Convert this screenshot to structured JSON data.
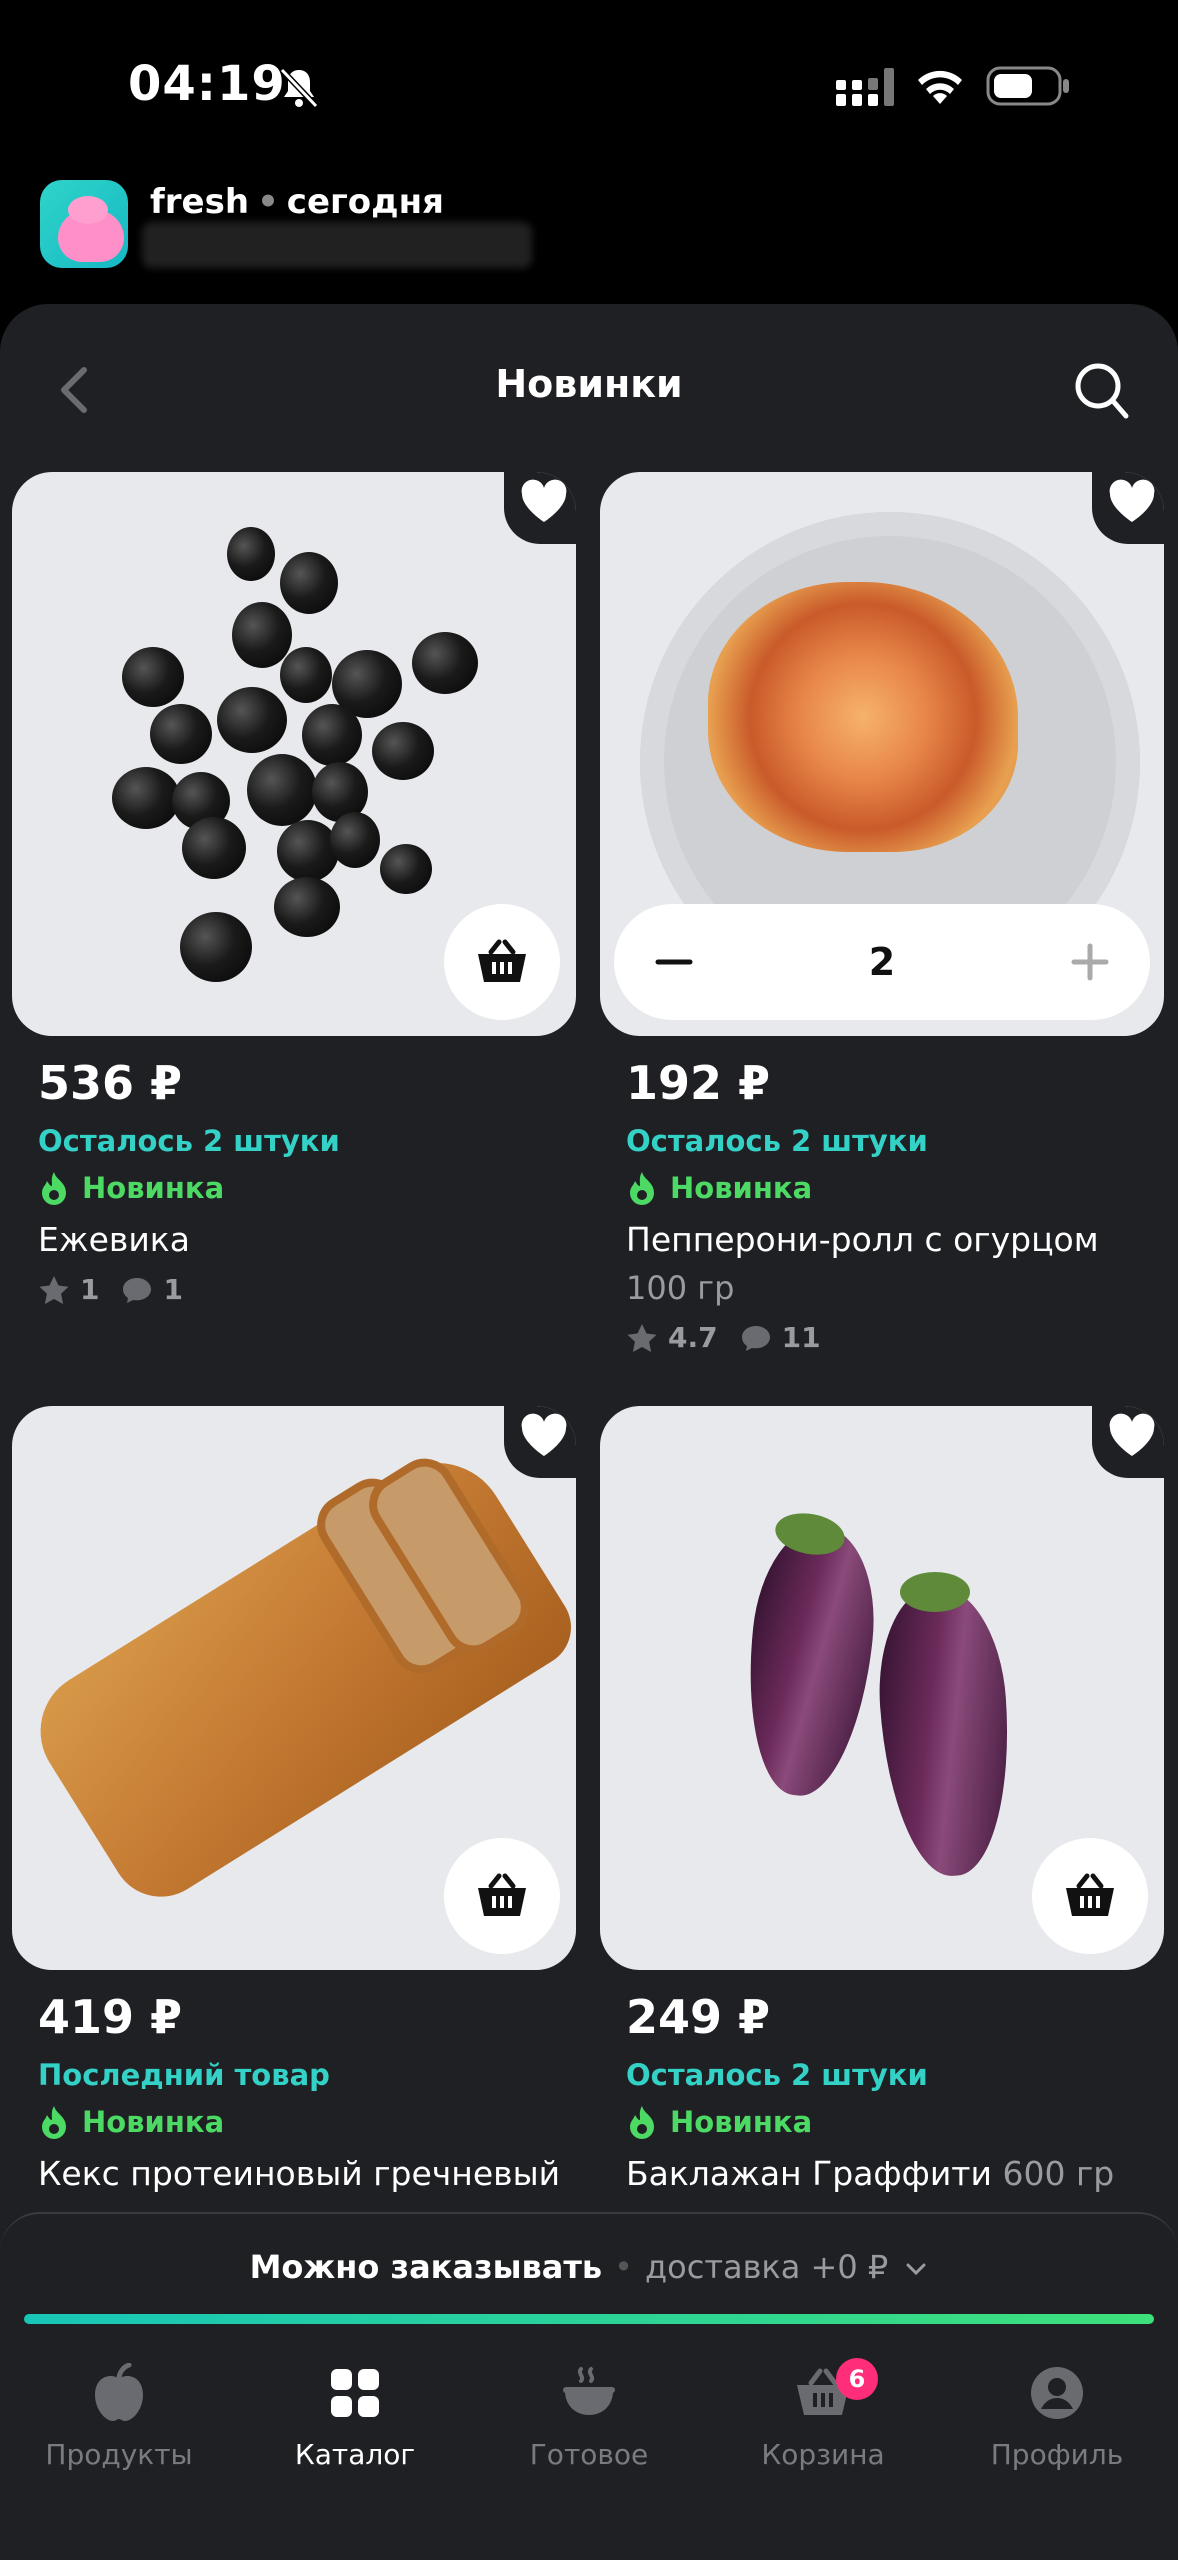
{
  "status_bar": {
    "time": "04:19"
  },
  "notification": {
    "app": "fresh",
    "separator": "•",
    "when": "сегодня"
  },
  "header": {
    "title": "Новинки"
  },
  "colors": {
    "accent": "#33d1c6",
    "new_badge": "#4cd964",
    "cart_badge": "#ff2d7a",
    "background": "#1f2024"
  },
  "products": [
    {
      "price": "536 ₽",
      "stock": "Осталось 2 штуки",
      "badge": "Новинка",
      "name": "Ежевика",
      "rating": "1",
      "reviews": "1"
    },
    {
      "price": "192 ₽",
      "stock": "Осталось 2 штуки",
      "badge": "Новинка",
      "name": "Пепперони-ролл с огурцом",
      "weight": "100 гр",
      "rating": "4.7",
      "reviews": "11",
      "quantity": "2"
    },
    {
      "price": "419 ₽",
      "stock": "Последний товар",
      "badge": "Новинка",
      "name": "Кекс протеиновый гречневый"
    },
    {
      "price": "249 ₽",
      "stock": "Осталось 2 штуки",
      "badge": "Новинка",
      "name": "Баклажан Граффити",
      "weight": "600 гр"
    }
  ],
  "order_panel": {
    "status": "Можно заказывать",
    "separator": "•",
    "delivery": "доставка +0 ₽",
    "progress": 1.0
  },
  "tabbar": {
    "items": [
      {
        "label": "Продукты",
        "icon": "apple-icon"
      },
      {
        "label": "Каталог",
        "icon": "grid-icon",
        "active": true
      },
      {
        "label": "Готовое",
        "icon": "hot-dish-icon"
      },
      {
        "label": "Корзина",
        "icon": "basket-icon",
        "badge": "6"
      },
      {
        "label": "Профиль",
        "icon": "profile-icon"
      }
    ]
  }
}
